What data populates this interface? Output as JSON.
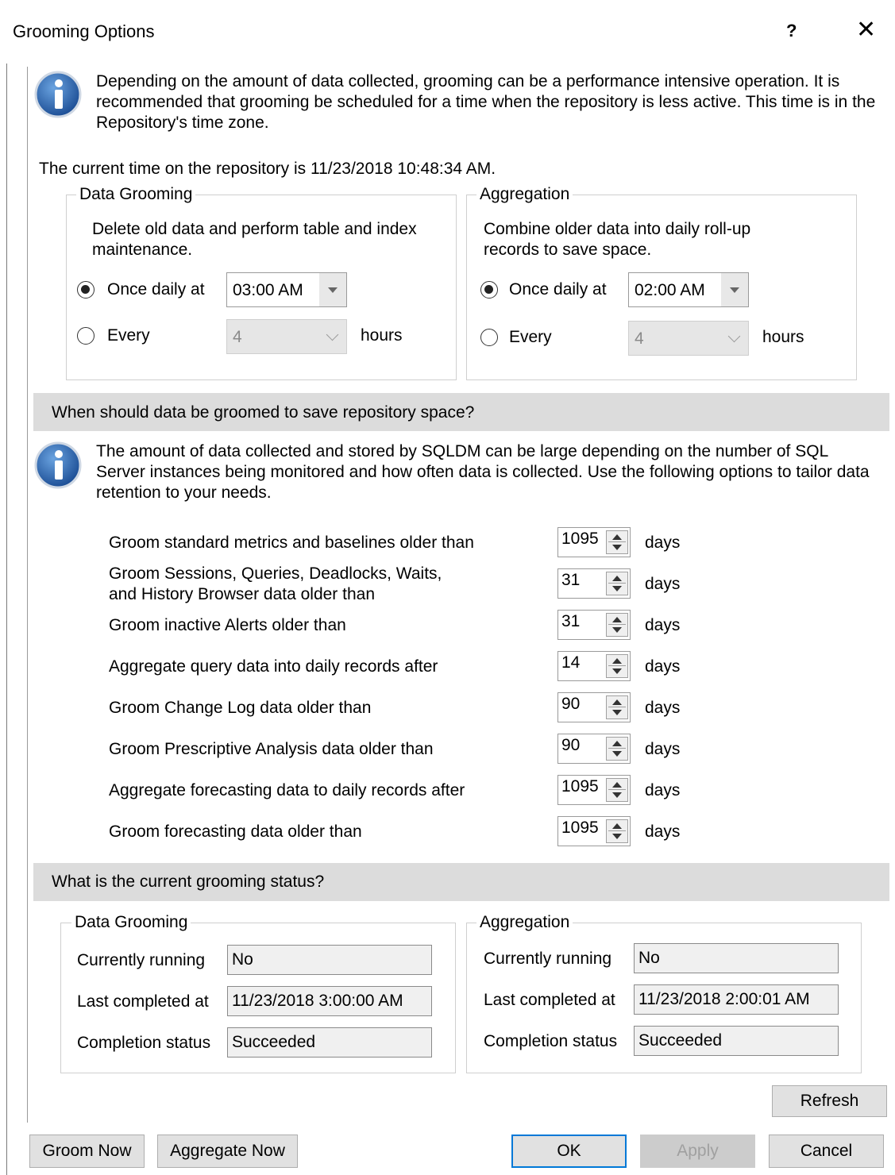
{
  "window": {
    "title": "Grooming Options",
    "help": "?",
    "close": "✕"
  },
  "intro": {
    "line1": "Depending on the amount of data collected, grooming can be a performance intensive operation. It is",
    "line2": "recommended that grooming be scheduled for a time when the repository is less active.  This time is in the",
    "line3": "Repository's time zone."
  },
  "current_time": "The current time on the repository is 11/23/2018 10:48:34 AM.",
  "schedule": {
    "grooming": {
      "title": "Data Grooming",
      "desc1": "Delete old data and perform table and index",
      "desc2": "maintenance.",
      "once_label": "Once daily at",
      "once_value": "03:00 AM",
      "every_label": "Every",
      "every_value": "4",
      "hours_label": "hours",
      "selected": "once"
    },
    "aggregation": {
      "title": "Aggregation",
      "desc1": "Combine older data into daily roll-up",
      "desc2": "records to save space.",
      "once_label": "Once daily at",
      "once_value": "02:00 AM",
      "every_label": "Every",
      "every_value": "4",
      "hours_label": "hours",
      "selected": "once"
    }
  },
  "retention": {
    "header": "When should data be groomed to save repository space?",
    "info1": "The amount of data collected and stored by SQLDM can be large depending on the number of SQL",
    "info2": "Server instances being monitored and how often data is collected. Use the following options to tailor data",
    "info3": "retention to your needs.",
    "unit": "days",
    "rows": [
      {
        "label": "Groom standard metrics and baselines older than",
        "label2": "",
        "value": "1095"
      },
      {
        "label": "Groom Sessions, Queries, Deadlocks, Waits,",
        "label2": "and History Browser data older than",
        "value": "31"
      },
      {
        "label": "Groom inactive Alerts older than",
        "label2": "",
        "value": "31"
      },
      {
        "label": "Aggregate query data into daily records after",
        "label2": "",
        "value": "14"
      },
      {
        "label": "Groom Change Log data older than",
        "label2": "",
        "value": "90"
      },
      {
        "label": "Groom Prescriptive Analysis data older than",
        "label2": "",
        "value": "90"
      },
      {
        "label": "Aggregate forecasting data to daily records after",
        "label2": "",
        "value": "1095"
      },
      {
        "label": "Groom forecasting data older than",
        "label2": "",
        "value": "1095"
      }
    ]
  },
  "status": {
    "header": "What is the current grooming status?",
    "grooming": {
      "title": "Data Grooming",
      "running_label": "Currently running",
      "running_value": "No",
      "last_label": "Last completed at",
      "last_value": "11/23/2018 3:00:00 AM",
      "status_label": "Completion status",
      "status_value": "Succeeded"
    },
    "aggregation": {
      "title": "Aggregation",
      "running_label": "Currently running",
      "running_value": "No",
      "last_label": "Last completed at",
      "last_value": "11/23/2018 2:00:01 AM",
      "status_label": "Completion status",
      "status_value": "Succeeded"
    },
    "refresh": "Refresh"
  },
  "footer": {
    "groom_now": "Groom Now",
    "aggregate_now": "Aggregate Now",
    "ok": "OK",
    "apply": "Apply",
    "cancel": "Cancel"
  },
  "colors": {
    "accent": "#0078d7",
    "info_icon": "#1f5fa8",
    "section_band": "#dcdcdc"
  }
}
